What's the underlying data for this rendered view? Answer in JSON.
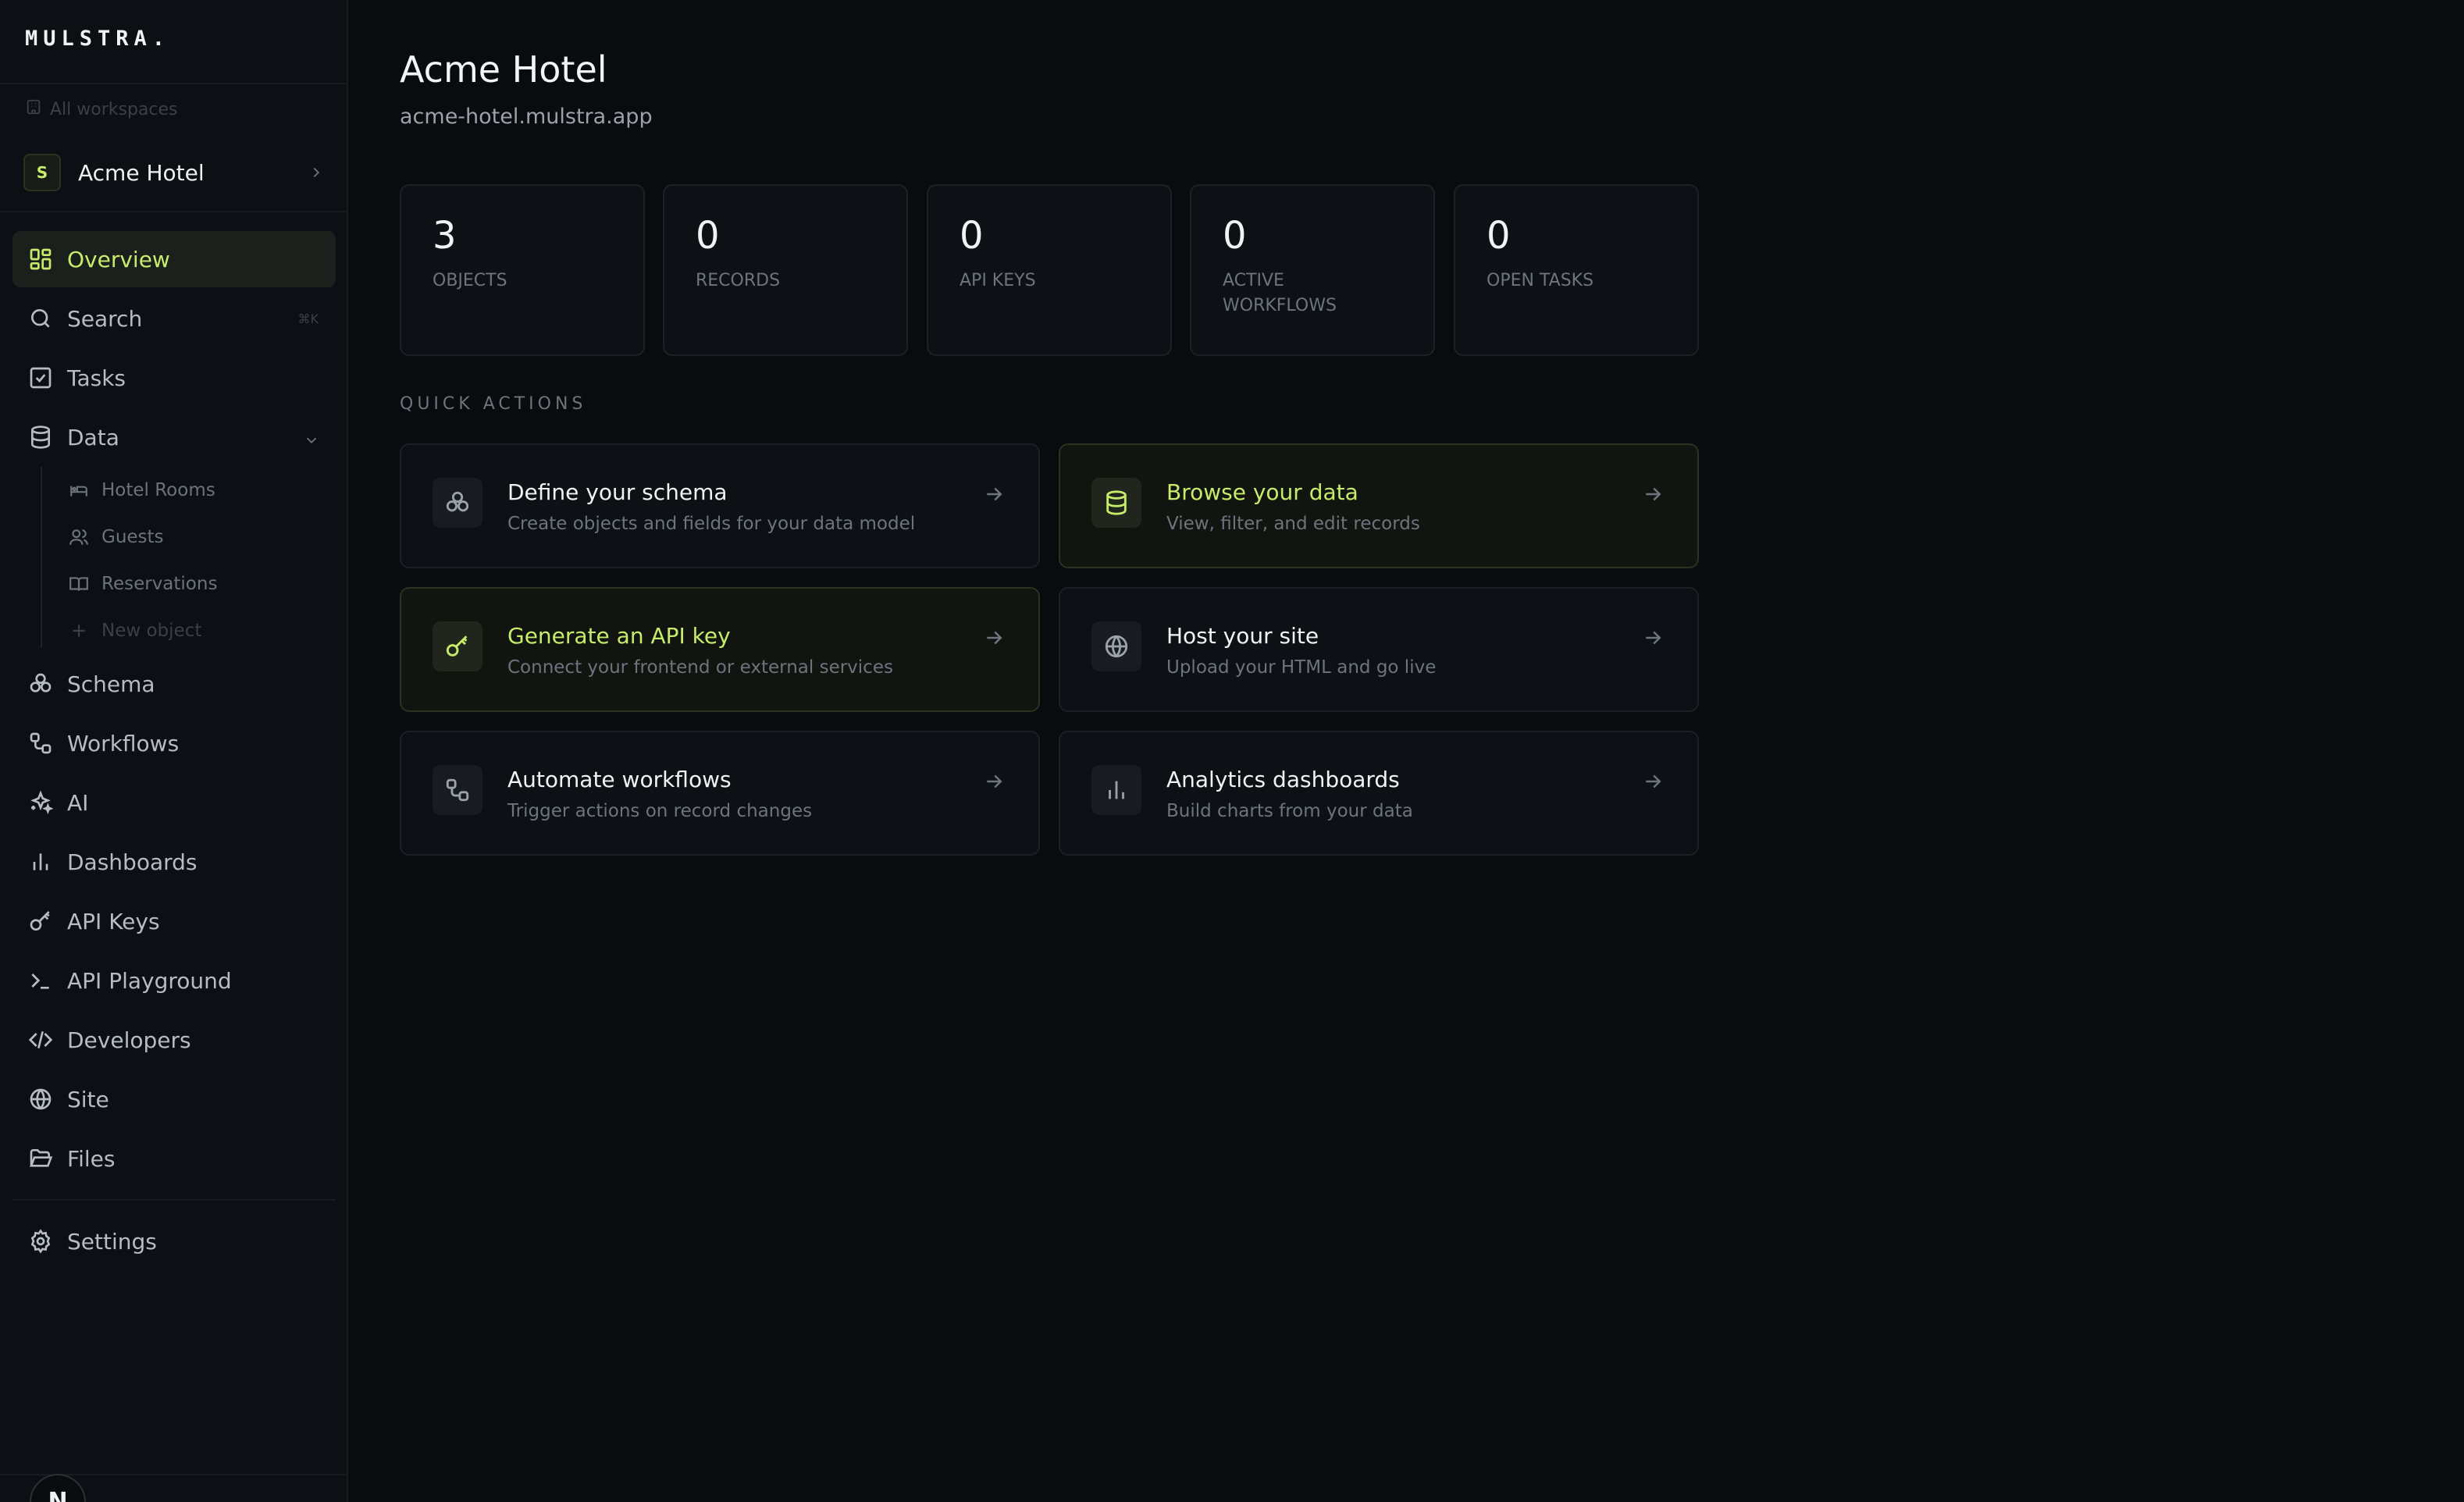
{
  "brand": {
    "logo": "MULSTRA."
  },
  "workspace": {
    "all_label": "All workspaces",
    "avatar_letter": "S",
    "name": "Acme Hotel"
  },
  "nav": {
    "overview": "Overview",
    "search": "Search",
    "search_shortcut": "⌘K",
    "tasks": "Tasks",
    "data": "Data",
    "data_children": [
      "Hotel Rooms",
      "Guests",
      "Reservations"
    ],
    "new_object": "New object",
    "schema": "Schema",
    "workflows": "Workflows",
    "ai": "AI",
    "dashboards": "Dashboards",
    "api_keys": "API Keys",
    "api_playground": "API Playground",
    "developers": "Developers",
    "site": "Site",
    "files": "Files",
    "settings": "Settings"
  },
  "user": {
    "initial": "N"
  },
  "header": {
    "title": "Acme Hotel",
    "subtitle": "acme-hotel.mulstra.app"
  },
  "stats": [
    {
      "value": "3",
      "label": "OBJECTS"
    },
    {
      "value": "0",
      "label": "RECORDS"
    },
    {
      "value": "0",
      "label": "API KEYS"
    },
    {
      "value": "0",
      "label": "ACTIVE WORKFLOWS"
    },
    {
      "value": "0",
      "label": "OPEN TASKS"
    }
  ],
  "quick_actions": {
    "title": "QUICK ACTIONS",
    "items": [
      {
        "title": "Define your schema",
        "desc": "Create objects and fields for your data model",
        "icon": "schema-icon"
      },
      {
        "title": "Browse your data",
        "desc": "View, filter, and edit records",
        "icon": "database-icon"
      },
      {
        "title": "Generate an API key",
        "desc": "Connect your frontend or external services",
        "icon": "key-icon"
      },
      {
        "title": "Host your site",
        "desc": "Upload your HTML and go live",
        "icon": "globe-icon"
      },
      {
        "title": "Automate workflows",
        "desc": "Trigger actions on record changes",
        "icon": "workflow-icon"
      },
      {
        "title": "Analytics dashboards",
        "desc": "Build charts from your data",
        "icon": "bar-chart-icon"
      }
    ]
  },
  "colors": {
    "accent": "#c7ec6b",
    "background": "#090b0e",
    "sidebar": "#0c0f13",
    "card": "#0d1115",
    "border": "#1c2127",
    "muted_text": "#6c747d"
  }
}
